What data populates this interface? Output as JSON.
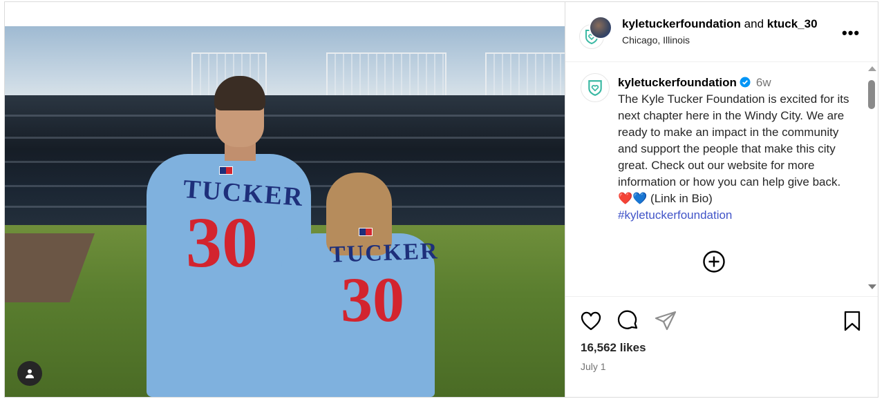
{
  "post": {
    "header": {
      "owner": "kyletuckerfoundation",
      "connector": "and",
      "collaborator": "ktuck_30",
      "location": "Chicago, Illinois",
      "more_label": "•••"
    },
    "caption": {
      "username": "kyletuckerfoundation",
      "time": "6w",
      "text": "The Kyle Tucker Foundation is excited for its next chapter here in the Windy City. We are ready to make an impact in the community and support the people that make this city great. Check out our website for more information or how you can help give back. ❤️💙 (Link in Bio)",
      "hashtag": "#kyletuckerfoundation"
    },
    "photo": {
      "jersey_name": "TUCKER",
      "jersey_number": "30"
    },
    "likes_text": "16,562 likes",
    "date": "July 1"
  },
  "icons": [
    "user-tag-icon",
    "foundation-logo-icon",
    "verified-badge-icon",
    "more-options-icon",
    "add-comment-icon",
    "heart-icon",
    "comment-icon",
    "share-icon",
    "bookmark-icon"
  ],
  "colors": {
    "verified": "#0095f6",
    "hashtag": "#4154c8",
    "foundation_teal": "#3bb9a4",
    "jersey_blue": "#7fb1de",
    "jersey_red": "#d3242e",
    "jersey_navy": "#1e2f7a"
  }
}
